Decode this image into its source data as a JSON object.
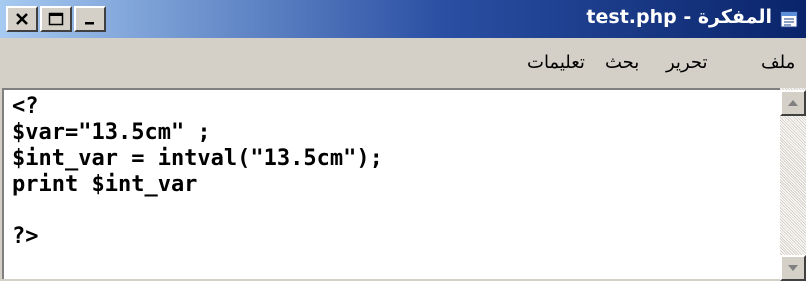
{
  "window": {
    "title": "test.php - المفكرة",
    "controls": [
      "close",
      "maximize",
      "minimize"
    ],
    "icon": "notepad-icon"
  },
  "menu": {
    "items": [
      "ملف",
      "تحرير",
      "بحث",
      "تعليمات"
    ]
  },
  "editor": {
    "lines": [
      "<?",
      "$var=\"13.5cm\" ;",
      "$int_var = intval(\"13.5cm\");",
      "print $int_var",
      "",
      "?>"
    ]
  },
  "colors": {
    "titlebar_start": "#0a246a",
    "titlebar_end": "#a6caf0",
    "chrome": "#d4d0c8"
  }
}
